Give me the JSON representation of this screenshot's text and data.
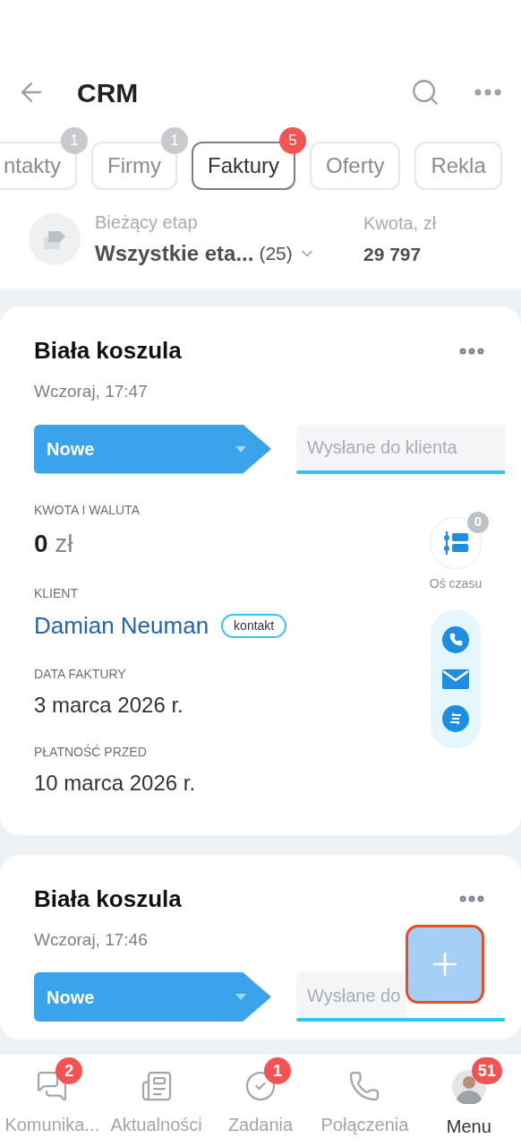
{
  "header": {
    "title": "CRM"
  },
  "tabs": [
    {
      "label": "ntakty",
      "badge": "1",
      "selected": false
    },
    {
      "label": "Firmy",
      "badge": "1",
      "selected": false
    },
    {
      "label": "Faktury",
      "badge": "5",
      "selected": true
    },
    {
      "label": "Oferty",
      "selected": false
    },
    {
      "label": "Rekla",
      "selected": false
    }
  ],
  "stage_filter": {
    "label": "Bieżący etap",
    "value": "Wszystkie eta...",
    "count": "(25)"
  },
  "amount": {
    "label": "Kwota, zł",
    "value": "29 797"
  },
  "cards": [
    {
      "title": "Biała koszula",
      "date": "Wczoraj, 17:47",
      "stage": "Nowe",
      "next_stage": "Wysłane do klienta",
      "fields": [
        {
          "kind": "amount",
          "label": "KWOTA I WALUTA",
          "value": "0",
          "currency": "zł"
        },
        {
          "kind": "client",
          "label": "KLIENT",
          "value": "Damian Neuman",
          "tag": "kontakt"
        },
        {
          "kind": "text",
          "label": "DATA FAKTURY",
          "value": "3 marca 2026 r."
        },
        {
          "kind": "text",
          "label": "PŁATNOŚĆ PRZED",
          "value": "10 marca 2026 r."
        }
      ],
      "timeline": {
        "label": "Oś czasu",
        "badge": "0"
      }
    },
    {
      "title": "Biała koszula",
      "date": "Wczoraj, 17:46",
      "stage": "Nowe",
      "next_stage": "Wysłane do"
    }
  ],
  "bottom_nav": [
    {
      "kind": "chat",
      "label": "Komunika...",
      "badge": "2",
      "selected": false
    },
    {
      "kind": "news",
      "label": "Aktualności",
      "selected": false
    },
    {
      "kind": "tasks",
      "label": "Zadania",
      "badge": "1",
      "selected": false
    },
    {
      "kind": "calls",
      "label": "Połączenia",
      "selected": false
    },
    {
      "kind": "avatar",
      "label": "Menu",
      "badge": "51",
      "selected": true
    }
  ]
}
